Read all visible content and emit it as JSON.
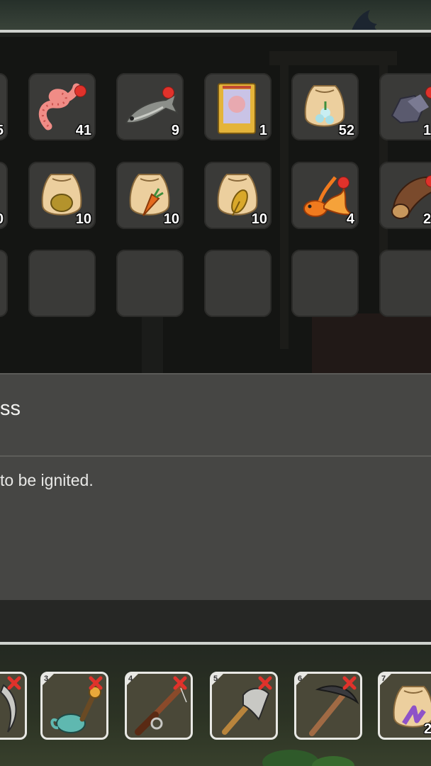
{
  "inventory": {
    "rows": [
      [
        {
          "name": "partial-item-left",
          "icon": "unknown-icon",
          "count": "5"
        },
        {
          "name": "worm",
          "icon": "worm-icon",
          "count": "41",
          "new": true
        },
        {
          "name": "fish",
          "icon": "fish-icon",
          "count": "9",
          "new": true
        },
        {
          "name": "card",
          "icon": "card-icon",
          "count": "1"
        },
        {
          "name": "flower-seed-bag",
          "icon": "seed-bag-flower-icon",
          "count": "52"
        },
        {
          "name": "ore",
          "icon": "ore-icon",
          "count": "1",
          "new": true
        }
      ],
      [
        {
          "name": "partial-item-left",
          "icon": "unknown-icon",
          "count": "0"
        },
        {
          "name": "potato-seed-bag",
          "icon": "seed-bag-potato-icon",
          "count": "10"
        },
        {
          "name": "carrot-seed-bag",
          "icon": "seed-bag-carrot-icon",
          "count": "10"
        },
        {
          "name": "wheat-seed-bag",
          "icon": "seed-bag-wheat-icon",
          "count": "10"
        },
        {
          "name": "goldfish",
          "icon": "goldfish-icon",
          "count": "4",
          "new": true
        },
        {
          "name": "wood-log",
          "icon": "log-icon",
          "count": "2",
          "new": true
        }
      ],
      [
        {
          "name": "empty",
          "icon": "",
          "count": ""
        },
        {
          "name": "empty",
          "icon": "",
          "count": ""
        },
        {
          "name": "empty",
          "icon": "",
          "count": ""
        },
        {
          "name": "empty",
          "icon": "",
          "count": ""
        },
        {
          "name": "empty",
          "icon": "",
          "count": ""
        },
        {
          "name": "empty",
          "icon": "",
          "count": ""
        }
      ]
    ]
  },
  "info": {
    "title": "ss",
    "description": "to be ignited."
  },
  "hotbar": [
    {
      "number": "",
      "icon": "scythe-icon",
      "count": ""
    },
    {
      "number": "3",
      "icon": "watering-can-icon",
      "count": ""
    },
    {
      "number": "4",
      "icon": "fishing-rod-icon",
      "count": ""
    },
    {
      "number": "5",
      "icon": "axe-icon",
      "count": ""
    },
    {
      "number": "6",
      "icon": "pickaxe-icon",
      "count": ""
    },
    {
      "number": "7",
      "icon": "seed-bag-lavender-icon",
      "count": "2"
    }
  ],
  "colors": {
    "new_dot": "#e0322b",
    "remove_x": "#e0322b",
    "slot_bg": "#3a3a38",
    "info_bg": "#464644"
  }
}
